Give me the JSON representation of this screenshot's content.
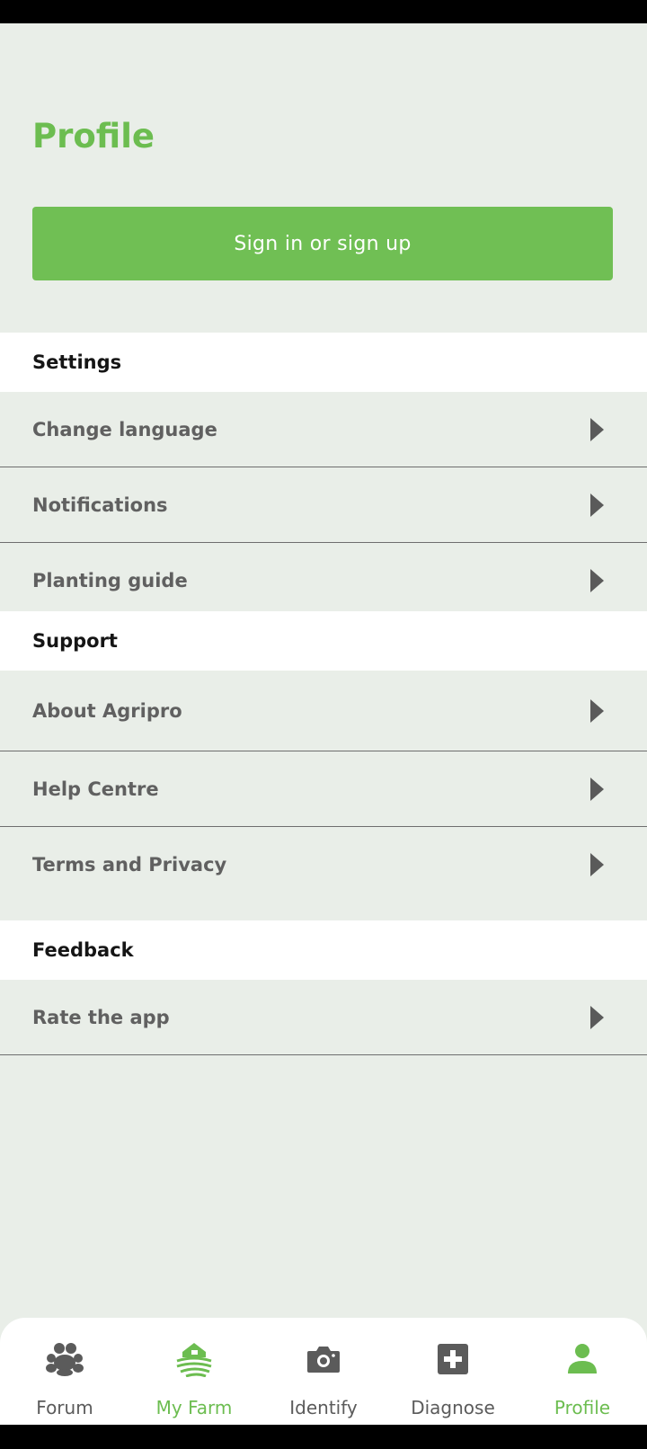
{
  "header": {
    "title": "Profile"
  },
  "auth": {
    "signin_label": "Sign in or sign up"
  },
  "settings": {
    "title": "Settings",
    "items": [
      {
        "label": "Change language"
      },
      {
        "label": "Notifications"
      },
      {
        "label": "Planting guide"
      }
    ]
  },
  "support": {
    "title": "Support",
    "items": [
      {
        "label": "About Agripro"
      },
      {
        "label": "Help Centre"
      },
      {
        "label": "Terms and Privacy"
      }
    ]
  },
  "feedback": {
    "title": "Feedback",
    "items": [
      {
        "label": "Rate the app"
      }
    ]
  },
  "bottom_nav": {
    "items": [
      {
        "label": "Forum",
        "icon": "forum-icon",
        "active": false
      },
      {
        "label": "My Farm",
        "icon": "farm-icon",
        "active": true
      },
      {
        "label": "Identify",
        "icon": "camera-icon",
        "active": false
      },
      {
        "label": "Diagnose",
        "icon": "diagnose-icon",
        "active": false
      },
      {
        "label": "Profile",
        "icon": "person-icon",
        "active": true
      }
    ]
  },
  "colors": {
    "accent": "#6cbd50",
    "button": "#70bf54",
    "background": "#e9eee8",
    "text_muted": "#606060"
  }
}
